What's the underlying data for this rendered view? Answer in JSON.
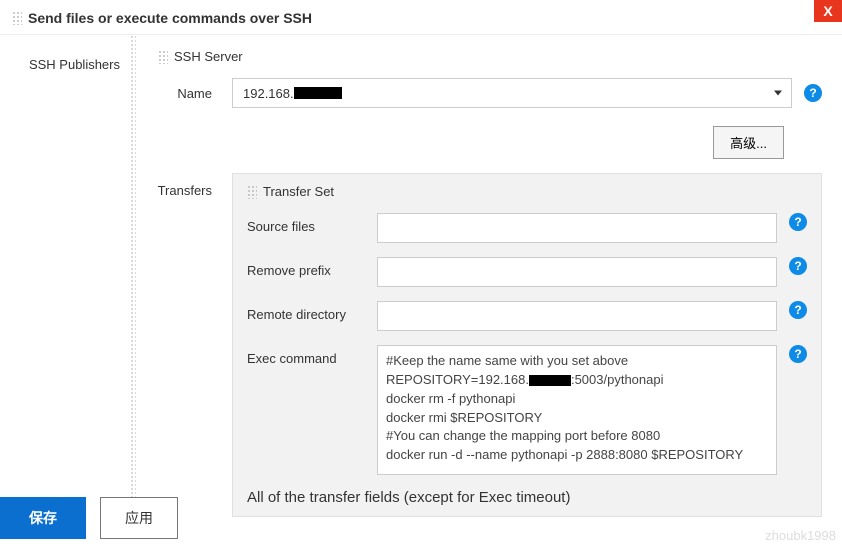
{
  "header": {
    "title": "Send files or execute commands over SSH"
  },
  "sidebar": {
    "label": "SSH Publishers"
  },
  "sshServer": {
    "title": "SSH Server",
    "nameLabel": "Name",
    "nameValuePrefix": "192.168.",
    "advancedButton": "高级..."
  },
  "transfers": {
    "label": "Transfers",
    "setTitle": "Transfer Set",
    "fields": {
      "sourceFiles": {
        "label": "Source files",
        "value": ""
      },
      "removePrefix": {
        "label": "Remove prefix",
        "value": ""
      },
      "remoteDirectory": {
        "label": "Remote directory",
        "value": ""
      },
      "execCommand": {
        "label": "Exec command",
        "lines": [
          "#Keep the name same with you set above",
          "REPOSITORY=192.168.",
          ":5003/pythonapi",
          "docker rm -f pythonapi",
          "docker rmi $REPOSITORY",
          "#You can change the mapping port before 8080",
          "docker run -d --name pythonapi  -p 2888:8080 $REPOSITORY"
        ]
      }
    },
    "note": "All of the transfer fields (except for Exec timeout)"
  },
  "footer": {
    "save": "保存",
    "apply": "应用"
  },
  "watermark": "zhoubk1998",
  "icons": {
    "help": "?",
    "close": "X"
  }
}
